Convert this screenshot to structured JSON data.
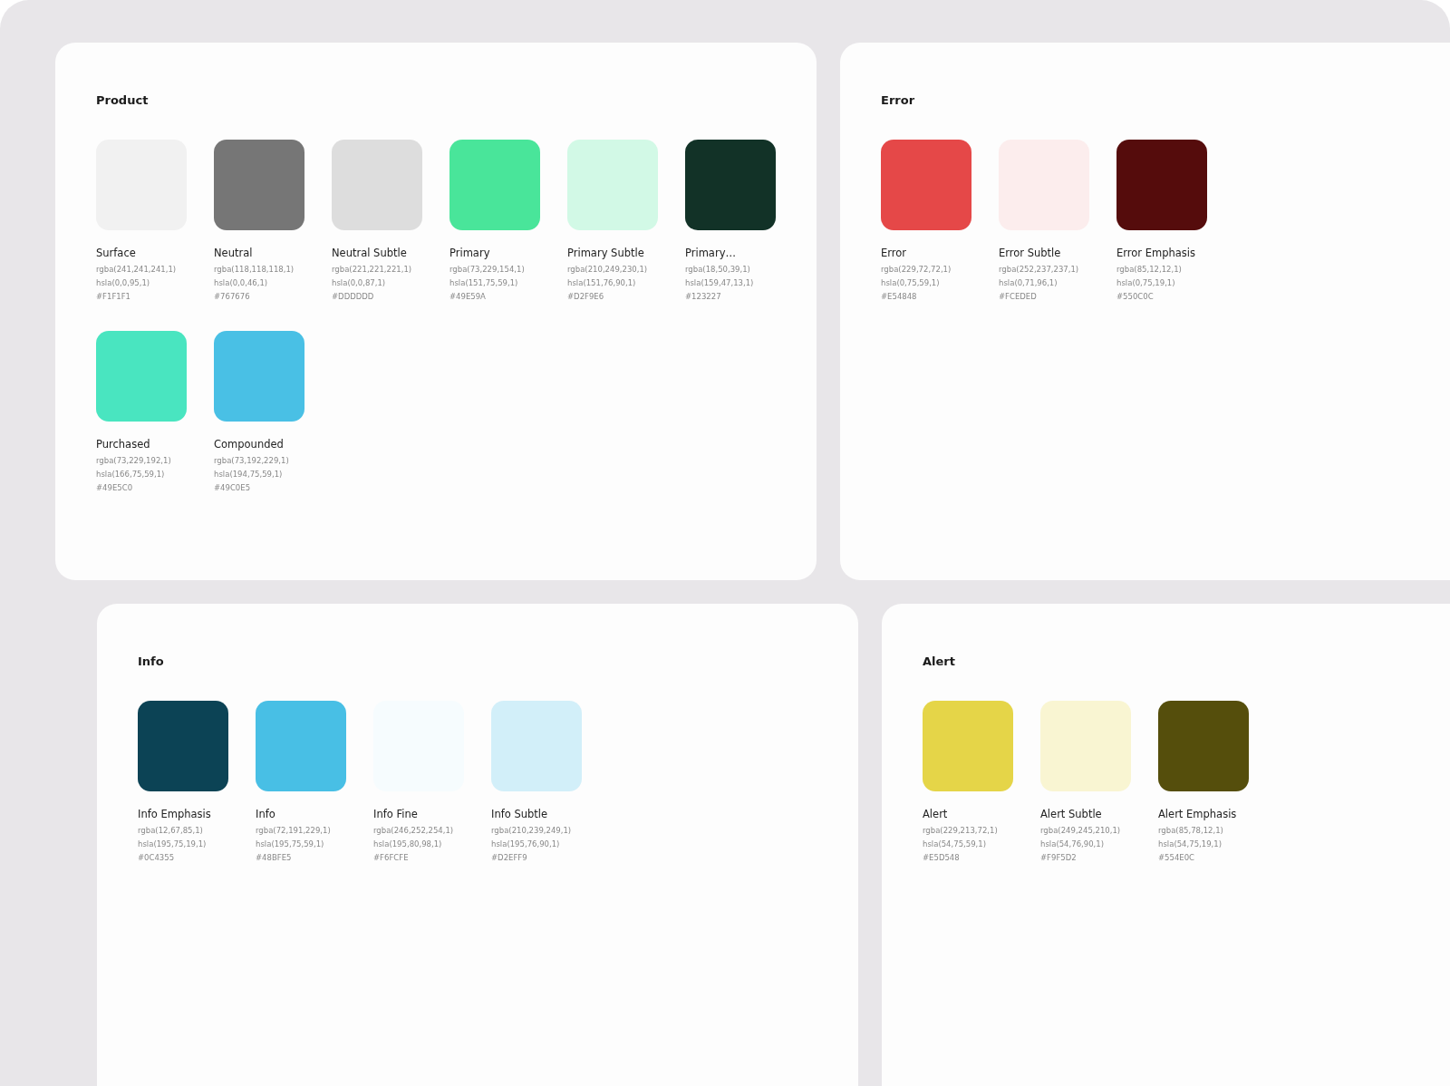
{
  "groups": [
    {
      "title": "Product",
      "swatches": [
        {
          "name": "Surface",
          "color": "#f1f1f1",
          "rgba": "rgba(241,241,241,1)",
          "hsla": "hsla(0,0,95,1)",
          "hex": "#F1F1F1"
        },
        {
          "name": "Neutral",
          "color": "#767676",
          "rgba": "rgba(118,118,118,1)",
          "hsla": "hsla(0,0,46,1)",
          "hex": "#767676"
        },
        {
          "name": "Neutral Subtle",
          "color": "#dddddd",
          "rgba": "rgba(221,221,221,1)",
          "hsla": "hsla(0,0,87,1)",
          "hex": "#DDDDDD"
        },
        {
          "name": "Primary",
          "color": "#49e59a",
          "rgba": "rgba(73,229,154,1)",
          "hsla": "hsla(151,75,59,1)",
          "hex": "#49E59A"
        },
        {
          "name": "Primary Subtle",
          "color": "#d2f9e6",
          "rgba": "rgba(210,249,230,1)",
          "hsla": "hsla(151,76,90,1)",
          "hex": "#D2F9E6"
        },
        {
          "name": "Primary…",
          "color": "#123227",
          "rgba": "rgba(18,50,39,1)",
          "hsla": "hsla(159,47,13,1)",
          "hex": "#123227"
        },
        {
          "name": "Purchased",
          "color": "#49e5c0",
          "rgba": "rgba(73,229,192,1)",
          "hsla": "hsla(166,75,59,1)",
          "hex": "#49E5C0"
        },
        {
          "name": "Compounded",
          "color": "#49c0e5",
          "rgba": "rgba(73,192,229,1)",
          "hsla": "hsla(194,75,59,1)",
          "hex": "#49C0E5"
        }
      ]
    },
    {
      "title": "Error",
      "swatches": [
        {
          "name": "Error",
          "color": "#e54848",
          "rgba": "rgba(229,72,72,1)",
          "hsla": "hsla(0,75,59,1)",
          "hex": "#E54848"
        },
        {
          "name": "Error Subtle",
          "color": "#fceded",
          "rgba": "rgba(252,237,237,1)",
          "hsla": "hsla(0,71,96,1)",
          "hex": "#FCEDED"
        },
        {
          "name": "Error Emphasis",
          "color": "#550c0c",
          "rgba": "rgba(85,12,12,1)",
          "hsla": "hsla(0,75,19,1)",
          "hex": "#550C0C"
        }
      ]
    },
    {
      "title": "Info",
      "swatches": [
        {
          "name": "Info Emphasis",
          "color": "#0c4355",
          "rgba": "rgba(12,67,85,1)",
          "hsla": "hsla(195,75,19,1)",
          "hex": "#0C4355"
        },
        {
          "name": "Info",
          "color": "#48bfe5",
          "rgba": "rgba(72,191,229,1)",
          "hsla": "hsla(195,75,59,1)",
          "hex": "#48BFE5"
        },
        {
          "name": "Info Fine",
          "color": "#f6fcfe",
          "rgba": "rgba(246,252,254,1)",
          "hsla": "hsla(195,80,98,1)",
          "hex": "#F6FCFE"
        },
        {
          "name": "Info Subtle",
          "color": "#d2eff9",
          "rgba": "rgba(210,239,249,1)",
          "hsla": "hsla(195,76,90,1)",
          "hex": "#D2EFF9"
        }
      ]
    },
    {
      "title": "Alert",
      "swatches": [
        {
          "name": "Alert",
          "color": "#e5d548",
          "rgba": "rgba(229,213,72,1)",
          "hsla": "hsla(54,75,59,1)",
          "hex": "#E5D548"
        },
        {
          "name": "Alert Subtle",
          "color": "#f9f5d2",
          "rgba": "rgba(249,245,210,1)",
          "hsla": "hsla(54,76,90,1)",
          "hex": "#F9F5D2"
        },
        {
          "name": "Alert Emphasis",
          "color": "#554e0c",
          "rgba": "rgba(85,78,12,1)",
          "hsla": "hsla(54,75,19,1)",
          "hex": "#554E0C"
        }
      ]
    }
  ]
}
